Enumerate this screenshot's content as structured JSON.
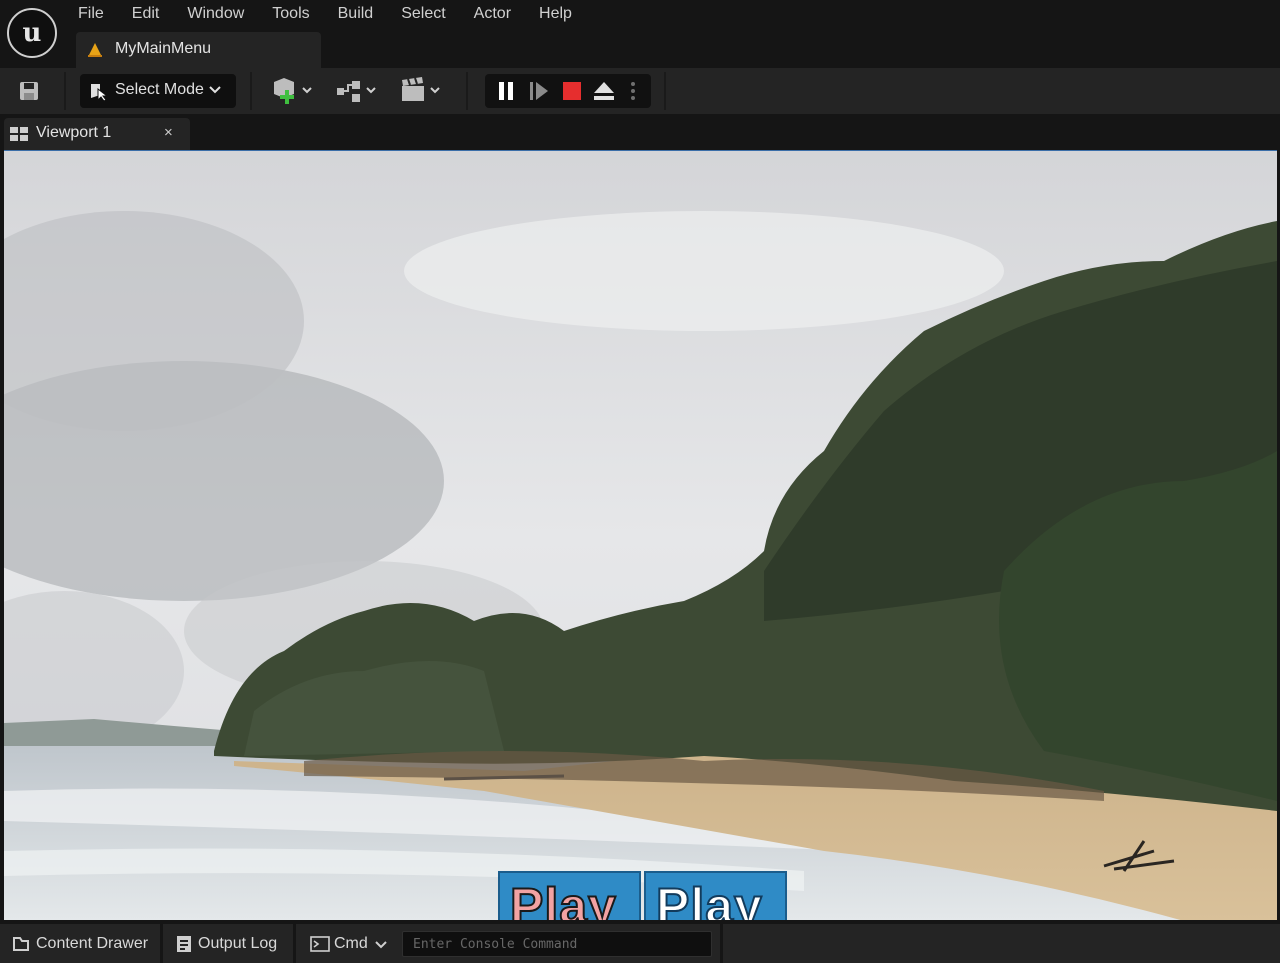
{
  "menu": {
    "items": [
      "File",
      "Edit",
      "Window",
      "Tools",
      "Build",
      "Select",
      "Actor",
      "Help"
    ]
  },
  "level_tab": {
    "label": "MyMainMenu"
  },
  "toolbar": {
    "select_mode_label": "Select Mode",
    "icons": [
      "save-icon",
      "select-mode-icon",
      "add-actor-icon",
      "blueprint-icon",
      "cinematics-icon",
      "pause-icon",
      "frame-skip-icon",
      "stop-icon",
      "eject-icon",
      "more-options-icon"
    ]
  },
  "viewport_tab": {
    "label": "Viewport 1",
    "close": "×"
  },
  "viewport": {
    "buttons": [
      {
        "label": "Play"
      },
      {
        "label": "Play"
      }
    ]
  },
  "bottom": {
    "content_drawer": "Content Drawer",
    "output_log": "Output Log",
    "cmd": "Cmd",
    "console_placeholder": "Enter Console Command"
  },
  "colors": {
    "accent_blue": "#3a6ea8",
    "stop_red": "#e62e2e",
    "play_button_blue": "#2f8bc6",
    "play_text_pink": "#f2a3a3"
  }
}
